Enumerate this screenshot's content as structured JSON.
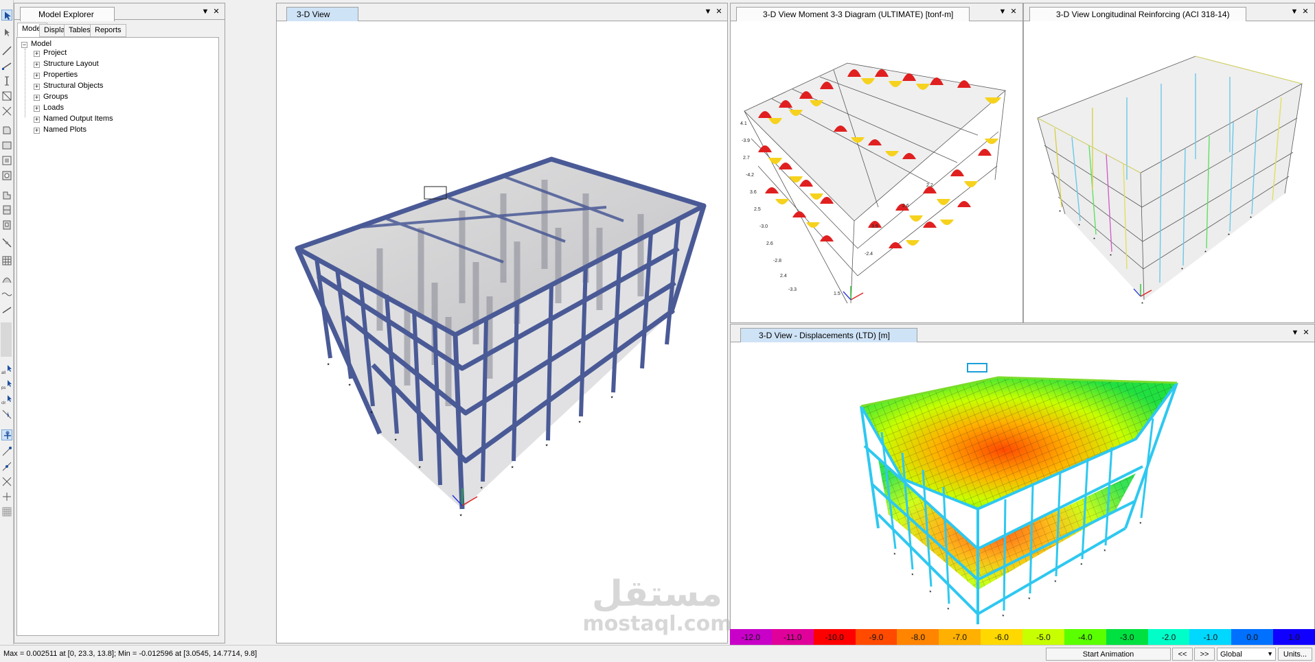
{
  "explorer": {
    "title": "Model Explorer",
    "tabs": [
      "Model",
      "Display",
      "Tables",
      "Reports"
    ],
    "tree_root": "Model",
    "tree_items": [
      "Project",
      "Structure Layout",
      "Properties",
      "Structural Objects",
      "Groups",
      "Loads",
      "Named Output Items",
      "Named Plots"
    ]
  },
  "views": {
    "main": {
      "title": "3-D View"
    },
    "moment": {
      "title": "3-D View   Moment 3-3 Diagram    (ULTIMATE)  [tonf-m]"
    },
    "rebar": {
      "title": "3-D View  Longitudinal Reinforcing  (ACI 318-14)"
    },
    "displacement": {
      "title": "3-D View   - Displacements (LTD)  [m]"
    }
  },
  "panel_controls": {
    "dropdown": "▼",
    "close": "✕"
  },
  "moment_values": [
    "4.1",
    "-3.9",
    "2.7",
    "-4.2",
    "3.6",
    "2.5",
    "-3.0",
    "2.6",
    "-2.8",
    "2.4",
    "-3.3",
    "1.5",
    "3.9",
    "2.6",
    "-2.4",
    "2.2"
  ],
  "colorbar": {
    "labels": [
      "-12.0",
      "-11.0",
      "-10.0",
      "-9.0",
      "-8.0",
      "-7.0",
      "-6.0",
      "-5.0",
      "-4.0",
      "-3.0",
      "-2.0",
      "-1.0",
      "0.0",
      "1.0"
    ],
    "colors": [
      "#c800c8",
      "#e0009a",
      "#ff0000",
      "#ff4a00",
      "#ff8400",
      "#ffb000",
      "#ffd800",
      "#c8ff00",
      "#5aff00",
      "#00e040",
      "#00ffc8",
      "#00d8ff",
      "#0070ff",
      "#1000ff"
    ]
  },
  "statusbar": {
    "text": "Max = 0.002511 at [0, 23.3, 13.8];  Min = -0.012596 at [3.0545, 14.7714, 9.8]",
    "animation": "Start Animation",
    "prev": "<<",
    "next": ">>",
    "coord_system": "Global",
    "units": "Units..."
  },
  "watermark": {
    "arabic": "مستقل",
    "latin": "mostaql.com"
  },
  "colors": {
    "frame": "#4a5a96",
    "active_tab": "#cfe3f7",
    "mesh": "#7bdc2a"
  }
}
